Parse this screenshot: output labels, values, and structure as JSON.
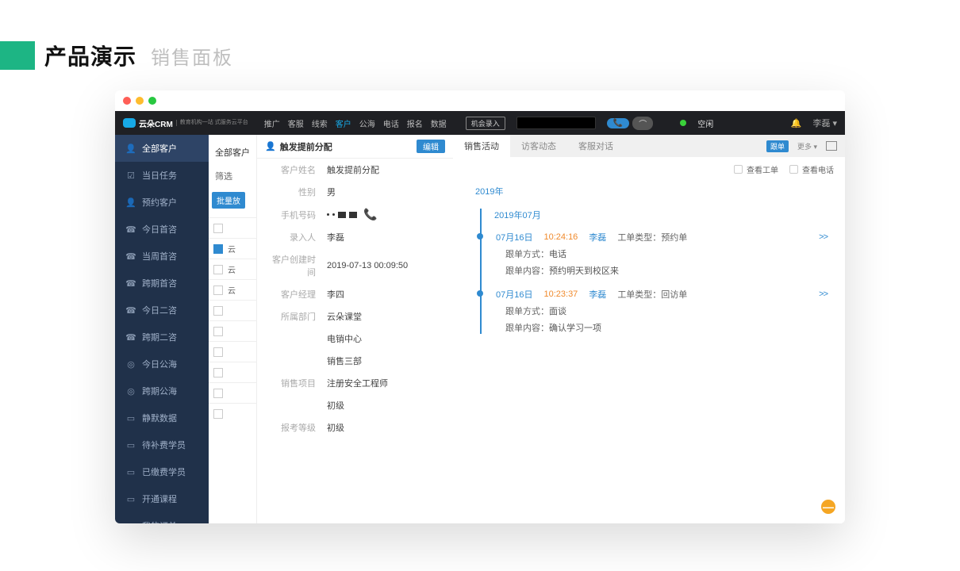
{
  "page": {
    "title": "产品演示",
    "subtitle": "销售面板"
  },
  "topnav": {
    "brand": "云朵CRM",
    "brand_tag": "教育机构一站\n式服务云平台",
    "items": [
      "推广",
      "客服",
      "线索",
      "客户",
      "公海",
      "电话",
      "报名",
      "数据"
    ],
    "active_index": 3,
    "opportunity": "机会录入",
    "phone_pill": "📞",
    "status_label": "空闲",
    "user_name": "李磊"
  },
  "sidebar": {
    "items": [
      {
        "icon": "👤",
        "label": "全部客户",
        "name": "all-customers"
      },
      {
        "icon": "☑",
        "label": "当日任务",
        "name": "today-tasks"
      },
      {
        "icon": "👤",
        "label": "预约客户",
        "name": "booked-customers"
      },
      {
        "icon": "☎",
        "label": "今日首咨",
        "name": "today-first-consult"
      },
      {
        "icon": "☎",
        "label": "当周首咨",
        "name": "week-first-consult"
      },
      {
        "icon": "☎",
        "label": "跨期首咨",
        "name": "cross-first-consult"
      },
      {
        "icon": "☎",
        "label": "今日二咨",
        "name": "today-second-consult"
      },
      {
        "icon": "☎",
        "label": "跨期二咨",
        "name": "cross-second-consult"
      },
      {
        "icon": "◎",
        "label": "今日公海",
        "name": "today-pool"
      },
      {
        "icon": "◎",
        "label": "跨期公海",
        "name": "cross-pool"
      },
      {
        "icon": "▭",
        "label": "静默数据",
        "name": "silent-data"
      },
      {
        "icon": "▭",
        "label": "待补费学员",
        "name": "pending-fee"
      },
      {
        "icon": "▭",
        "label": "已缴费学员",
        "name": "paid-students"
      },
      {
        "icon": "▭",
        "label": "开通课程",
        "name": "open-courses"
      },
      {
        "icon": "▭",
        "label": "我的订单",
        "name": "my-orders"
      }
    ],
    "active_index": 0
  },
  "list": {
    "title": "全部客户",
    "filter_label": "筛选",
    "batch_btn": "批量放",
    "visible_rows": [
      "",
      "云",
      "云",
      "云",
      "",
      "",
      "",
      "",
      "",
      ""
    ]
  },
  "detail": {
    "header_title": "触发提前分配",
    "edit_btn": "编辑",
    "fields": [
      {
        "label": "客户姓名",
        "value": "触发提前分配"
      },
      {
        "label": "性别",
        "value": "男"
      },
      {
        "label": "手机号码",
        "value": "",
        "phone": true
      },
      {
        "label": "录入人",
        "value": "李磊"
      },
      {
        "label": "客户创建时间",
        "value": "2019-07-13 00:09:50"
      },
      {
        "label": "客户经理",
        "value": "李四"
      },
      {
        "label": "所属部门",
        "value": "云朵课堂"
      },
      {
        "label": "",
        "value": "电销中心"
      },
      {
        "label": "",
        "value": "销售三部"
      },
      {
        "label": "销售项目",
        "value": "注册安全工程师"
      },
      {
        "label": "",
        "value": "初级"
      },
      {
        "label": "报考等级",
        "value": "初级"
      }
    ]
  },
  "activity": {
    "tabs": [
      "销售活动",
      "访客动态",
      "客服对话"
    ],
    "active_tab": 0,
    "right_btn_follow": "跟单",
    "right_btn_more": "更多",
    "filter_ticket": "查看工单",
    "filter_phone": "查看电话",
    "year": "2019年",
    "month": "2019年07月",
    "entries": [
      {
        "date": "07月16日",
        "time": "10:24:16",
        "user": "李磊",
        "type_label": "工单类型：",
        "type_value": "预约单",
        "method_label": "跟单方式：",
        "method_value": "电话",
        "content_label": "跟单内容：",
        "content_value": "预约明天到校区来",
        "expand": ">>"
      },
      {
        "date": "07月16日",
        "time": "10:23:37",
        "user": "李磊",
        "type_label": "工单类型：",
        "type_value": "回访单",
        "method_label": "跟单方式：",
        "method_value": "面谈",
        "content_label": "跟单内容：",
        "content_value": "确认学习一项",
        "expand": ">>"
      }
    ]
  }
}
